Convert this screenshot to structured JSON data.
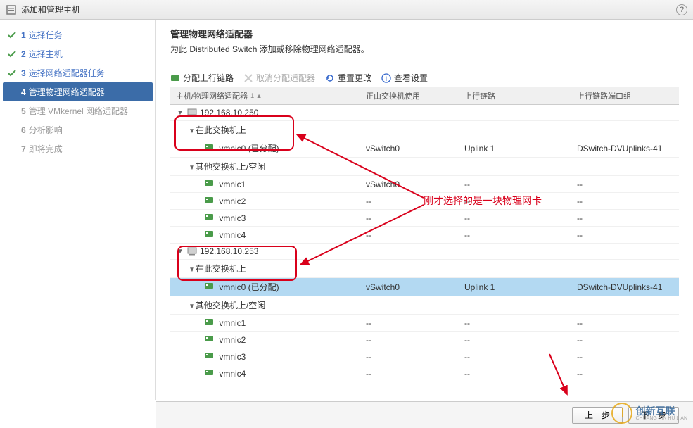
{
  "title": "添加和管理主机",
  "steps": [
    {
      "num": "1",
      "label": "选择任务",
      "state": "done"
    },
    {
      "num": "2",
      "label": "选择主机",
      "state": "done"
    },
    {
      "num": "3",
      "label": "选择网络适配器任务",
      "state": "done"
    },
    {
      "num": "4",
      "label": "管理物理网络适配器",
      "state": "current"
    },
    {
      "num": "5",
      "label": "管理 VMkernel 网络适配器",
      "state": "future"
    },
    {
      "num": "6",
      "label": "分析影响",
      "state": "future"
    },
    {
      "num": "7",
      "label": "即将完成",
      "state": "future"
    }
  ],
  "page": {
    "heading": "管理物理网络适配器",
    "description": "为此 Distributed Switch 添加或移除物理网络适配器。"
  },
  "toolbar": {
    "assign": "分配上行链路",
    "unassign": "取消分配适配器",
    "reset": "重置更改",
    "view": "查看设置"
  },
  "columns": {
    "name": "主机/物理网络适配器",
    "switch": "正由交换机使用",
    "uplink": "上行链路",
    "port": "上行链路端口组"
  },
  "hosts": [
    {
      "ip": "192.168.10.250",
      "onThisSwitch": "在此交换机上",
      "assigned": [
        {
          "name": "vmnic0 (已分配)",
          "switch": "vSwitch0",
          "uplink": "Uplink 1",
          "port": "DSwitch-DVUplinks-41",
          "selected": false
        }
      ],
      "otherLabel": "其他交换机上/空闲",
      "other": [
        {
          "name": "vmnic1",
          "switch": "vSwitch0",
          "uplink": "--",
          "port": "--"
        },
        {
          "name": "vmnic2",
          "switch": "--",
          "uplink": "--",
          "port": "--"
        },
        {
          "name": "vmnic3",
          "switch": "--",
          "uplink": "--",
          "port": "--"
        },
        {
          "name": "vmnic4",
          "switch": "--",
          "uplink": "--",
          "port": "--"
        }
      ]
    },
    {
      "ip": "192.168.10.253",
      "onThisSwitch": "在此交换机上",
      "assigned": [
        {
          "name": "vmnic0 (已分配)",
          "switch": "vSwitch0",
          "uplink": "Uplink 1",
          "port": "DSwitch-DVUplinks-41",
          "selected": true
        }
      ],
      "otherLabel": "其他交换机上/空闲",
      "other": [
        {
          "name": "vmnic1",
          "switch": "--",
          "uplink": "--",
          "port": "--"
        },
        {
          "name": "vmnic2",
          "switch": "--",
          "uplink": "--",
          "port": "--"
        },
        {
          "name": "vmnic3",
          "switch": "--",
          "uplink": "--",
          "port": "--"
        },
        {
          "name": "vmnic4",
          "switch": "--",
          "uplink": "--",
          "port": "--"
        }
      ]
    }
  ],
  "footer": {
    "back": "上一步",
    "next": "下一步"
  },
  "annotation": "刚才选择的是一块物理网卡",
  "watermark": {
    "main": "创新互联",
    "sub": "CHUANG XIN HU LIAN"
  }
}
